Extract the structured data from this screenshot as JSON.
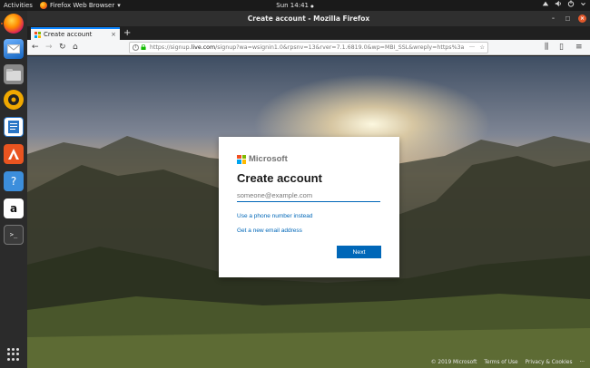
{
  "topbar": {
    "activities": "Activities",
    "app_name": "Firefox Web Browser",
    "app_menu_arrow": "▾",
    "clock": "Sun 14:41",
    "clock_dot": "●"
  },
  "window": {
    "title": "Create account - Mozilla Firefox",
    "minimize": "–",
    "maximize": "□",
    "close": "×"
  },
  "tab": {
    "label": "Create account",
    "close": "×",
    "new_tab": "+"
  },
  "address": {
    "url_prefix": "https://signup.",
    "url_domain": "live.com",
    "url_rest": "/signup?wa=wsignin1.0&rpsnv=13&rver=7.1.6819.0&wp=MBI_SSL&wreply=https%3a",
    "more": "···",
    "star": "☆"
  },
  "toolbar": {
    "back": "←",
    "forward": "→",
    "reload": "↻",
    "home": "⌂",
    "library": "⫼",
    "sidebar": "▯",
    "menu": "≡"
  },
  "card": {
    "brand": "Microsoft",
    "heading": "Create account",
    "email_placeholder": "someone@example.com",
    "phone_link": "Use a phone number instead",
    "new_email_link": "Get a new email address",
    "next_label": "Next"
  },
  "footer": {
    "copyright": "© 2019 Microsoft",
    "terms": "Terms of Use",
    "privacy": "Privacy & Cookies",
    "more": "···"
  },
  "colors": {
    "ms_red": "#f25022",
    "ms_green": "#7fba00",
    "ms_blue": "#00a4ef",
    "ms_yellow": "#ffb900",
    "accent": "#0067b8"
  },
  "dock": [
    {
      "name": "firefox-icon"
    },
    {
      "name": "thunderbird-icon"
    },
    {
      "name": "files-icon"
    },
    {
      "name": "rhythmbox-icon"
    },
    {
      "name": "libreoffice-writer-icon"
    },
    {
      "name": "software-center-icon"
    },
    {
      "name": "help-icon",
      "glyph": "?"
    },
    {
      "name": "amazon-icon",
      "glyph": "a"
    },
    {
      "name": "terminal-icon",
      "glyph": ">_"
    }
  ]
}
